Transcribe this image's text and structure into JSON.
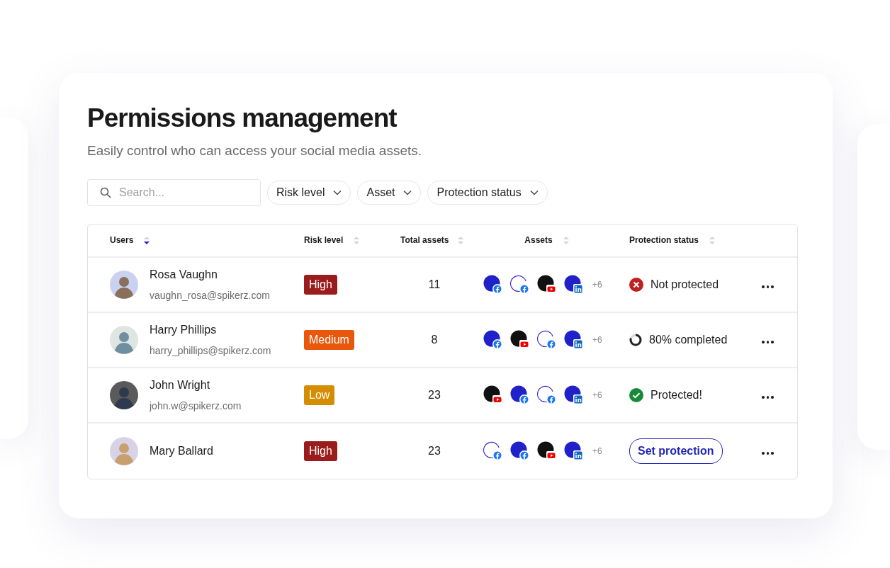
{
  "header": {
    "title": "Permissions management",
    "subtitle": "Easily control who can access your social media assets."
  },
  "search": {
    "placeholder": "Search..."
  },
  "filters": [
    {
      "label": "Risk level"
    },
    {
      "label": "Asset"
    },
    {
      "label": "Protection status"
    }
  ],
  "table": {
    "columns": [
      {
        "label": "Users",
        "sorted": true
      },
      {
        "label": "Risk level",
        "sorted": false
      },
      {
        "label": "Total assets",
        "sorted": false
      },
      {
        "label": "Assets",
        "sorted": false
      },
      {
        "label": "Protection status",
        "sorted": false
      }
    ],
    "rows": [
      {
        "name": "Rosa Vaughn",
        "email": "vaughn_rosa@spikerz.com",
        "risk": {
          "label": "High",
          "color": "#9b1c1c"
        },
        "total": "11",
        "assets": [
          {
            "kind": "solid-facebook"
          },
          {
            "kind": "outline-facebook"
          },
          {
            "kind": "dark-youtube"
          },
          {
            "kind": "solid-linkedin"
          }
        ],
        "more": "+6",
        "status": {
          "kind": "not_protected",
          "label": "Not protected"
        }
      },
      {
        "name": "Harry Phillips",
        "email": "harry_phillips@spikerz.com",
        "risk": {
          "label": "Medium",
          "color": "#e8570c"
        },
        "total": "8",
        "assets": [
          {
            "kind": "solid-facebook"
          },
          {
            "kind": "dark-youtube"
          },
          {
            "kind": "outline-facebook"
          },
          {
            "kind": "solid-linkedin"
          }
        ],
        "more": "+6",
        "status": {
          "kind": "progress",
          "label": "80% completed",
          "level": 0.8
        }
      },
      {
        "name": "John Wright",
        "email": "john.w@spikerz.com",
        "risk": {
          "label": "Low",
          "color": "#d48c00"
        },
        "total": "23",
        "assets": [
          {
            "kind": "dark-youtube"
          },
          {
            "kind": "solid-facebook"
          },
          {
            "kind": "outline-facebook"
          },
          {
            "kind": "solid-linkedin"
          }
        ],
        "more": "+6",
        "status": {
          "kind": "protected",
          "label": "Protected!"
        }
      },
      {
        "name": "Mary Ballard",
        "risk": {
          "label": "High",
          "color": "#9b1c1c"
        },
        "total": "23",
        "assets": [
          {
            "kind": "outline-facebook"
          },
          {
            "kind": "solid-facebook"
          },
          {
            "kind": "dark-youtube"
          },
          {
            "kind": "solid-linkedin"
          }
        ],
        "more": "+6",
        "status": {
          "kind": "action",
          "label": "Set protection"
        }
      }
    ]
  }
}
